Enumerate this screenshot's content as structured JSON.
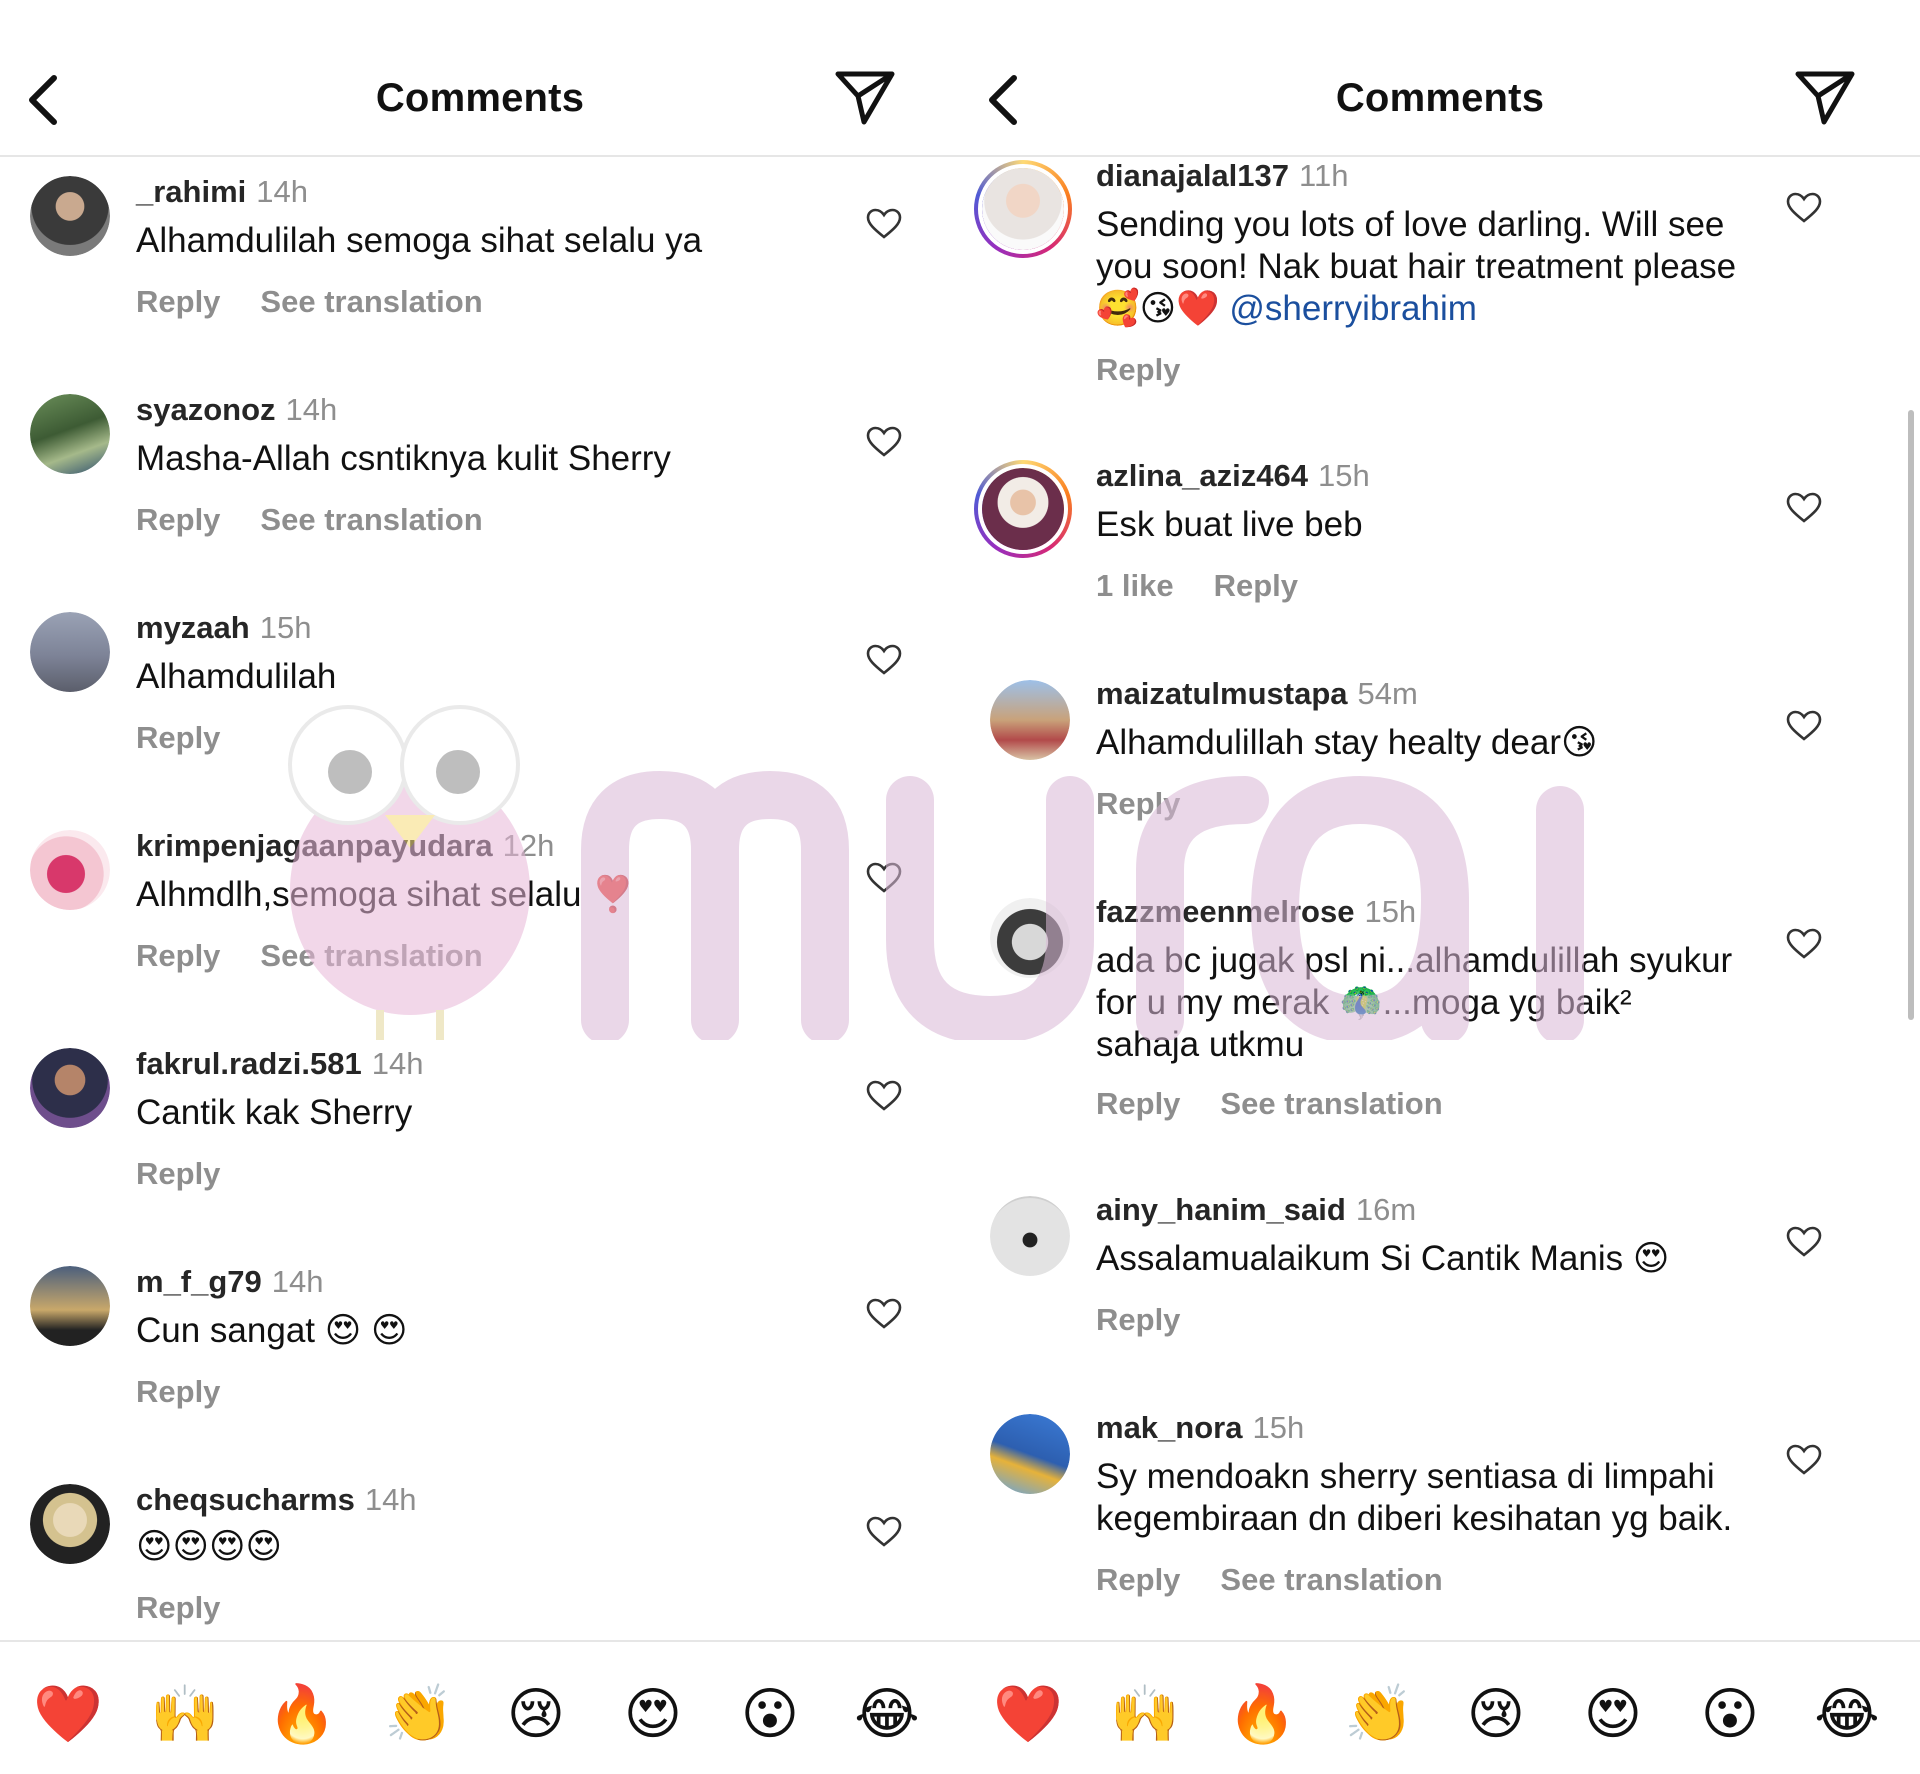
{
  "left": {
    "header": {
      "title": "Comments"
    },
    "comments": [
      {
        "username": "_rahimi",
        "time": "14h",
        "text": "Alhamdulilah semoga sihat selalu ya",
        "reply": "Reply",
        "translation": "See translation"
      },
      {
        "username": "syazonoz",
        "time": "14h",
        "text": "Masha-Allah csntiknya kulit Sherry",
        "reply": "Reply",
        "translation": "See translation"
      },
      {
        "username": "myzaah",
        "time": "15h",
        "text": "Alhamdulilah",
        "reply": "Reply"
      },
      {
        "username": "krimpenjagaanpayudara",
        "time": "12h",
        "text": "Alhmdlh,semoga sihat selalu ❣️",
        "reply": "Reply",
        "translation": "See translation"
      },
      {
        "username": "fakrul.radzi.581",
        "time": "14h",
        "text": "Cantik kak Sherry",
        "reply": "Reply"
      },
      {
        "username": "m_f_g79",
        "time": "14h",
        "text": "Cun sangat 😍 😍",
        "reply": "Reply"
      },
      {
        "username": "cheqsucharms",
        "time": "14h",
        "text": "😍😍😍😍",
        "reply": "Reply"
      }
    ],
    "reactions": [
      "❤️",
      "🙌",
      "🔥",
      "👏",
      "😢",
      "😍",
      "😮",
      "😂"
    ]
  },
  "right": {
    "header": {
      "title": "Comments"
    },
    "comments": [
      {
        "username": "dianajalal137",
        "time": "11h",
        "text_line1": "Sending you lots of love darling. Will see",
        "text_line2": "you soon! Nak buat hair treatment please",
        "text_emojis": "🥰😘❤️",
        "mention": "@sherryibrahim",
        "reply": "Reply"
      },
      {
        "username": "azlina_aziz464",
        "time": "15h",
        "text": "Esk buat live beb",
        "likes": "1 like",
        "reply": "Reply"
      },
      {
        "username": "maizatulmustapa",
        "time": "54m",
        "text": "Alhamdulillah stay healty dear😘",
        "reply": "Reply"
      },
      {
        "username": "fazzmeenmelrose",
        "time": "15h",
        "text_line1": "ada bc jugak psl ni...alhamdulillah syukur",
        "text_line2": "for u my merak 🦚...moga yg baik²",
        "text_line3": "sahaja utkmu",
        "reply": "Reply",
        "translation": "See translation"
      },
      {
        "username": "ainy_hanim_said",
        "time": "16m",
        "text": "Assalamualaikum Si Cantik Manis 😍",
        "reply": "Reply"
      },
      {
        "username": "mak_nora",
        "time": "15h",
        "text_line1": "Sy mendoakn sherry sentiasa di limpahi",
        "text_line2": "kegembiraan dn diberi kesihatan yg baik.",
        "reply": "Reply",
        "translation": "See translation"
      }
    ],
    "reactions": [
      "❤️",
      "🙌",
      "🔥",
      "👏",
      "😢",
      "😍",
      "😮",
      "😂"
    ]
  },
  "watermark": {
    "text": "murai"
  },
  "colors": {
    "username": "#262626",
    "meta": "#8e8e8e",
    "mention": "#1b4f9e",
    "divider": "#e6e6e6"
  },
  "icons": {
    "back": "chevron-left-icon",
    "send": "paper-plane-icon",
    "like": "heart-outline-icon"
  }
}
